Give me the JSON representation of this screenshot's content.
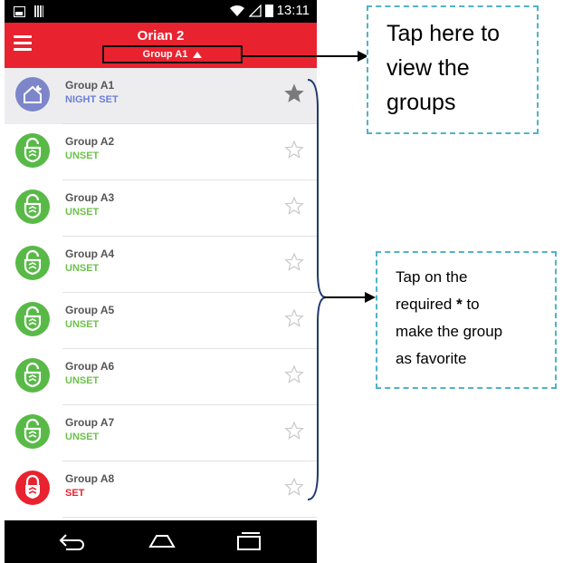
{
  "status_bar": {
    "time": "13:11"
  },
  "app_bar": {
    "title": "Orian 2",
    "group_selector": "Group A1"
  },
  "groups": [
    {
      "name": "Group A1",
      "state": "NIGHT SET",
      "state_color": "#6b7fd6",
      "icon": "home-night-icon",
      "icon_bg": "#7d86c9",
      "favorite": true,
      "selected": true
    },
    {
      "name": "Group A2",
      "state": "UNSET",
      "state_color": "#6cc24a",
      "icon": "unlocked-shield-icon",
      "icon_bg": "#58b947",
      "favorite": false,
      "selected": false
    },
    {
      "name": "Group A3",
      "state": "UNSET",
      "state_color": "#6cc24a",
      "icon": "unlocked-shield-icon",
      "icon_bg": "#58b947",
      "favorite": false,
      "selected": false
    },
    {
      "name": "Group A4",
      "state": "UNSET",
      "state_color": "#6cc24a",
      "icon": "unlocked-shield-icon",
      "icon_bg": "#58b947",
      "favorite": false,
      "selected": false
    },
    {
      "name": "Group A5",
      "state": "UNSET",
      "state_color": "#6cc24a",
      "icon": "unlocked-shield-icon",
      "icon_bg": "#58b947",
      "favorite": false,
      "selected": false
    },
    {
      "name": "Group A6",
      "state": "UNSET",
      "state_color": "#6cc24a",
      "icon": "unlocked-shield-icon",
      "icon_bg": "#58b947",
      "favorite": false,
      "selected": false
    },
    {
      "name": "Group A7",
      "state": "UNSET",
      "state_color": "#6cc24a",
      "icon": "unlocked-shield-icon",
      "icon_bg": "#58b947",
      "favorite": false,
      "selected": false
    },
    {
      "name": "Group A8",
      "state": "SET",
      "state_color": "#e8232f",
      "icon": "locked-shield-icon",
      "icon_bg": "#e8232f",
      "favorite": false,
      "selected": false
    }
  ],
  "annotations": {
    "top": [
      "Tap here to",
      "view the",
      "groups"
    ],
    "mid": {
      "line1": "Tap on the",
      "line2_pre": "required ",
      "line2_bold": "*",
      "line2_post": " to",
      "line3": "make the group",
      "line4": "as favorite"
    }
  },
  "colors": {
    "accent": "#e8232f",
    "callout_border": "#4fb3c8",
    "bracket": "#1f3a6e"
  }
}
